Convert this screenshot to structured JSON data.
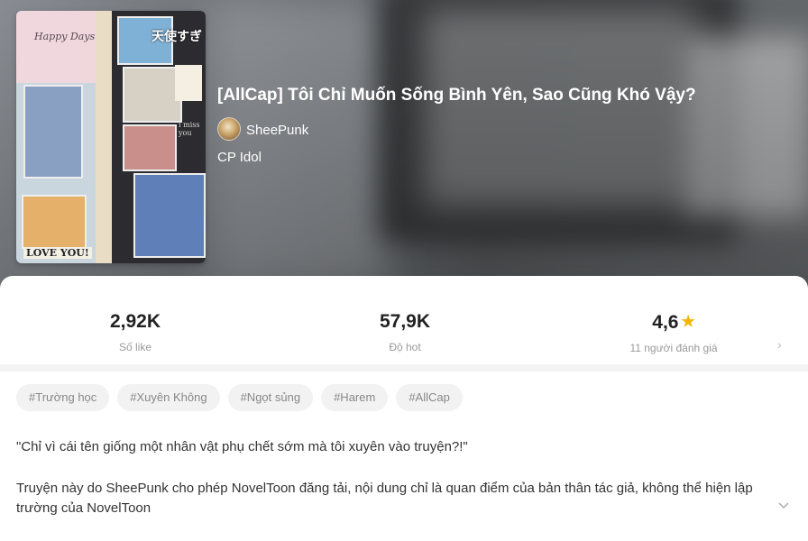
{
  "book": {
    "title": "[AllCap] Tôi Chỉ Muốn Sống Bình Yên, Sao Cũng Khó Vậy?",
    "author": "SheePunk",
    "category": "CP Idol",
    "cover_text": {
      "happy_days": "Happy Days",
      "japanese": "天使すぎ",
      "love_you": "LOVE YOU!",
      "miss_you": "i miss you"
    }
  },
  "stats": {
    "likes": {
      "value": "2,92K",
      "label": "Số like"
    },
    "hot": {
      "value": "57,9K",
      "label": "Độ hot"
    },
    "rating": {
      "value": "4,6",
      "label": "11 người đánh giá"
    }
  },
  "tags": [
    "#Trường học",
    "#Xuyên Không",
    "#Ngọt sủng",
    "#Harem",
    "#AllCap"
  ],
  "description": {
    "quote": "\"Chỉ vì cái tên giống một nhân vật phụ chết sớm mà tôi xuyên vào truyện?!\"",
    "body": "Truyện này do SheePunk cho phép NovelToon đăng tải, nội dung chỉ là quan điểm của bản thân tác giả, không thể hiện lập trường của NovelToon"
  },
  "icons": {
    "rating_star": "star-icon",
    "rating_more": "chevron-right-icon",
    "expand": "chevron-down-icon"
  },
  "colors": {
    "star": "#f4b400",
    "tag_bg": "#f2f2f2",
    "tag_text": "#888888"
  }
}
